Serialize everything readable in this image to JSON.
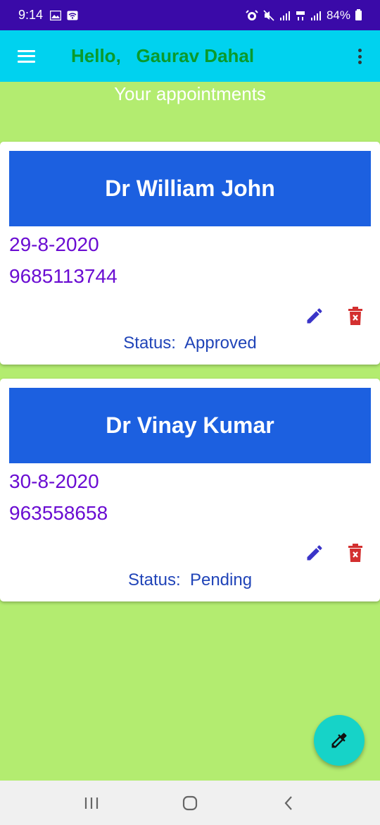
{
  "status_bar": {
    "time": "9:14",
    "battery": "84%"
  },
  "app_bar": {
    "title": "Hello,   Gaurav Dahal",
    "menu_icon": "hamburger-menu-icon",
    "overflow_icon": "more-vert-icon"
  },
  "page": {
    "heading": "Your appointments"
  },
  "appointments": [
    {
      "doctor": "Dr William John",
      "date": "29-8-2020",
      "phone": "9685113744",
      "status": "Status:  Approved"
    },
    {
      "doctor": "Dr Vinay Kumar",
      "date": "30-8-2020",
      "phone": "963558658",
      "status": "Status:  Pending"
    }
  ],
  "fab": {
    "icon": "eyedropper-icon"
  },
  "colors": {
    "status_bar": "#3a0aa8",
    "app_bar": "#00d2ef",
    "background": "#b3ec70",
    "banner": "#1c60e0",
    "title_green": "#0a9a2c",
    "text_purple": "#6a0cd2",
    "status_blue": "#2044b8",
    "edit_icon": "#3a34c8",
    "delete_icon": "#d32f2f",
    "fab": "#16d3c8"
  }
}
